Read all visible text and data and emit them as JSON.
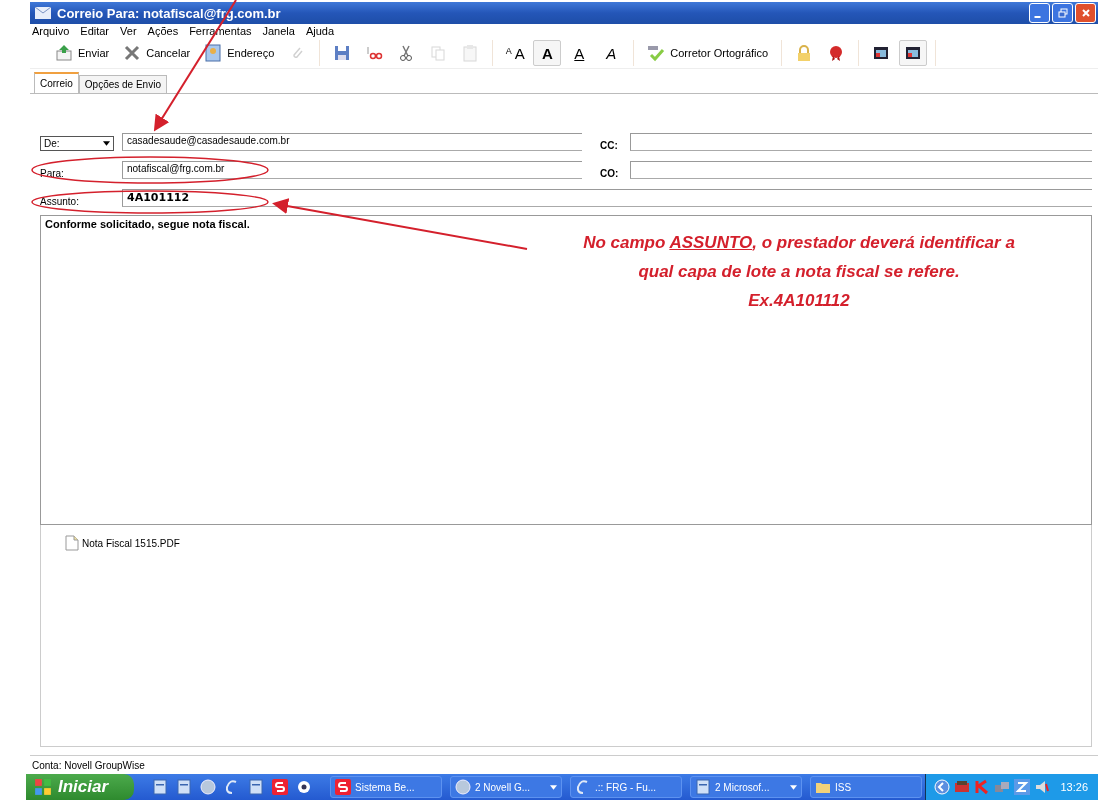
{
  "window": {
    "title": "Correio Para: notafiscal@frg.com.br"
  },
  "menu": [
    "Arquivo",
    "Editar",
    "Ver",
    "Ações",
    "Ferramentas",
    "Janela",
    "Ajuda"
  ],
  "toolbar": [
    [
      {
        "kind": "send",
        "label": "Enviar",
        "disabled": false,
        "pressed": false
      },
      {
        "kind": "cancel",
        "label": "Cancelar",
        "disabled": false,
        "pressed": false
      },
      {
        "kind": "address",
        "label": "Endereço",
        "disabled": false,
        "pressed": false
      },
      {
        "kind": "attach",
        "disabled": true,
        "pressed": false
      }
    ],
    [
      {
        "kind": "save",
        "disabled": false,
        "pressed": false
      },
      {
        "kind": "signature",
        "disabled": false,
        "pressed": false
      },
      {
        "kind": "cut",
        "disabled": false,
        "pressed": false
      },
      {
        "kind": "copy",
        "disabled": true,
        "pressed": false
      },
      {
        "kind": "paste",
        "disabled": true,
        "pressed": false
      }
    ],
    [
      {
        "kind": "size",
        "label": "AA",
        "disabled": false,
        "pressed": false
      },
      {
        "kind": "bold",
        "label": "A",
        "disabled": false,
        "pressed": true
      },
      {
        "kind": "underline",
        "label": "A",
        "disabled": false,
        "pressed": false
      },
      {
        "kind": "italic",
        "label": "A",
        "disabled": false,
        "pressed": false
      }
    ],
    [
      {
        "kind": "spell",
        "label": "Corretor Ortográfico",
        "disabled": false,
        "pressed": false
      }
    ],
    [
      {
        "kind": "lock",
        "disabled": false,
        "pressed": false
      },
      {
        "kind": "seal",
        "disabled": false,
        "pressed": false
      }
    ],
    [
      {
        "kind": "view",
        "disabled": false,
        "pressed": false
      },
      {
        "kind": "view",
        "disabled": false,
        "pressed": true
      }
    ]
  ],
  "tabs": [
    {
      "label": "Correio",
      "selected": true
    },
    {
      "label": "Opções de Envio",
      "selected": false
    }
  ],
  "header": {
    "from_selector": "De:",
    "from": "casadesaude@casadesaude.com.br",
    "to_label": "Para:",
    "to": "notafiscal@frg.com.br",
    "subject_label": "Assunto:",
    "subject": "4A101112",
    "cc_label": "CC:",
    "co_label": "CO:"
  },
  "body": "Conforme solicitado, segue nota fiscal.",
  "attachments": [
    "Nota Fiscal 1515.PDF"
  ],
  "annotation": {
    "before": "No campo ",
    "emphasis": "ASSUNTO",
    "after": ", o prestador deverá identificar a qual capa de lote a nota fiscal se refere.",
    "example": "Ex.4A101112"
  },
  "status_bar": "Conta: Novell GroupWise",
  "taskbar": {
    "start": "Iniciar",
    "tasks": [
      {
        "kind": "s",
        "label": "Sistema Be...",
        "grouped": false
      },
      {
        "kind": "globe",
        "label": "2 Novell G...",
        "grouped": true
      },
      {
        "kind": "browser",
        "label": ".:: FRG - Fu...",
        "grouped": false
      },
      {
        "kind": "doc",
        "label": "2 Microsof...",
        "grouped": true
      },
      {
        "kind": "folder",
        "label": "ISS",
        "grouped": false
      }
    ],
    "time": "13:26"
  }
}
